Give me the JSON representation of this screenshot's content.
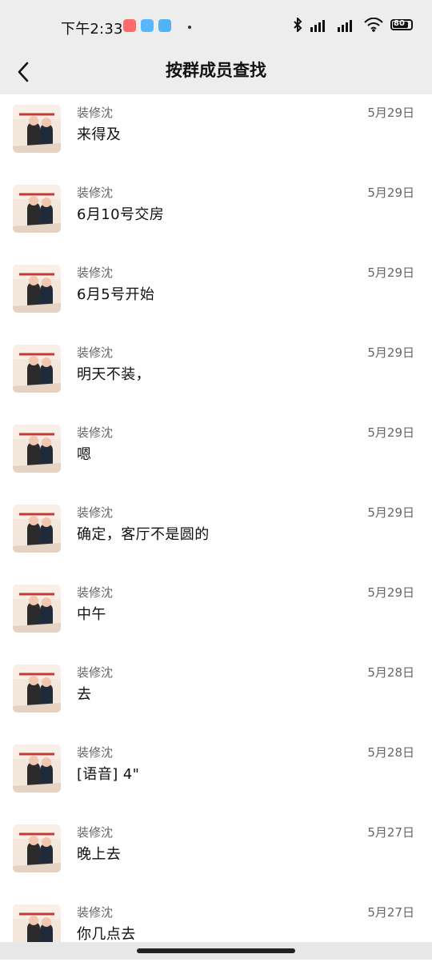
{
  "status": {
    "time": "下午2:33",
    "battery": "80"
  },
  "header": {
    "title": "按群成员查找"
  },
  "messages": [
    {
      "sender": "装修沈",
      "date": "5月29日",
      "text": "来得及"
    },
    {
      "sender": "装修沈",
      "date": "5月29日",
      "text": "6月10号交房"
    },
    {
      "sender": "装修沈",
      "date": "5月29日",
      "text": "6月5号开始"
    },
    {
      "sender": "装修沈",
      "date": "5月29日",
      "text": "明天不装，"
    },
    {
      "sender": "装修沈",
      "date": "5月29日",
      "text": "嗯"
    },
    {
      "sender": "装修沈",
      "date": "5月29日",
      "text": "确定，客厅不是圆的"
    },
    {
      "sender": "装修沈",
      "date": "5月29日",
      "text": "中午"
    },
    {
      "sender": "装修沈",
      "date": "5月28日",
      "text": "去"
    },
    {
      "sender": "装修沈",
      "date": "5月28日",
      "text": "[语音] 4\""
    },
    {
      "sender": "装修沈",
      "date": "5月27日",
      "text": "晚上去"
    },
    {
      "sender": "装修沈",
      "date": "5月27日",
      "text": "你几点去"
    }
  ]
}
